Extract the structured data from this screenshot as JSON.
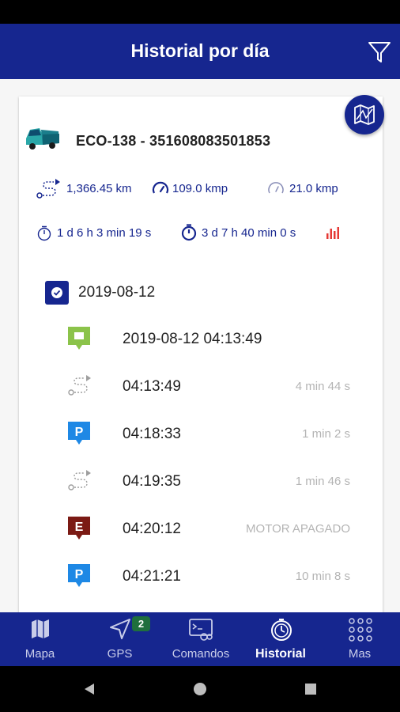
{
  "app_bar": {
    "title": "Historial por día",
    "filter_icon": "filter-icon"
  },
  "vehicle": {
    "title": "ECO-138 - 351608083501853",
    "icon": "truck-icon"
  },
  "stats": {
    "distance": "1,366.45 km",
    "max_speed": "109.0 kmp",
    "avg_speed": "21.0 kmp",
    "moving_time": "1 d 6 h 3 min 19 s",
    "total_time": "3 d 7 h 40 min 0 s"
  },
  "day": {
    "date": "2019-08-12"
  },
  "events": [
    {
      "type": "start",
      "time": "2019-08-12 04:13:49",
      "duration": "",
      "color": "#8bc34a"
    },
    {
      "type": "route",
      "time": "04:13:49",
      "duration": "4 min 44 s",
      "color": "#9e9e9e"
    },
    {
      "type": "parking",
      "time": "04:18:33",
      "duration": "1 min 2 s",
      "color": "#1e88e5"
    },
    {
      "type": "route",
      "time": "04:19:35",
      "duration": "1 min 46 s",
      "color": "#9e9e9e"
    },
    {
      "type": "engine-off",
      "time": "04:20:12",
      "duration": "MOTOR APAGADO",
      "color": "#7b1a14"
    },
    {
      "type": "parking",
      "time": "04:21:21",
      "duration": "10 min 8 s",
      "color": "#1e88e5"
    }
  ],
  "nav": {
    "items": [
      {
        "label": "Mapa",
        "icon": "map-icon"
      },
      {
        "label": "GPS",
        "icon": "navigation-arrow-icon",
        "badge": "2"
      },
      {
        "label": "Comandos",
        "icon": "commands-icon"
      },
      {
        "label": "Historial",
        "icon": "history-icon",
        "active": true
      },
      {
        "label": "Mas",
        "icon": "grid-dots-icon"
      }
    ]
  },
  "colors": {
    "primary": "#16268f",
    "accent_red": "#e53935",
    "badge_green": "#1f6f3d"
  }
}
